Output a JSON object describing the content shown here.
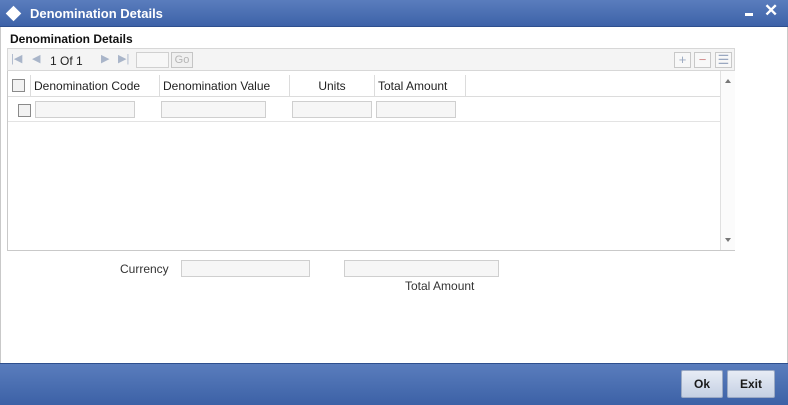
{
  "window": {
    "title": "Denomination Details",
    "icon": "diamond-icon",
    "minimize_icon": "minimize-icon",
    "close_icon": "close-icon",
    "close_glyph": "✕"
  },
  "section": {
    "label": "Denomination Details"
  },
  "toolbar": {
    "first_glyph": "|◀",
    "prev_glyph": "◀",
    "next_glyph": "▶",
    "last_glyph": "▶|",
    "page_text": "1 Of 1",
    "goto_value": "",
    "go_label": "Go",
    "add_glyph": "+",
    "delete_glyph": "−",
    "view_glyph": "☰"
  },
  "grid": {
    "columns": [
      "Denomination Code",
      "Denomination Value",
      "Units",
      "Total Amount"
    ],
    "rows": [
      {
        "code": "",
        "value": "",
        "units": "",
        "total": ""
      }
    ]
  },
  "summary": {
    "currency_label": "Currency",
    "currency_value": "",
    "total_amount_label": "Total Amount",
    "total_amount_value": ""
  },
  "footer": {
    "ok_label": "Ok",
    "exit_label": "Exit"
  },
  "colors": {
    "titlebar": "#3d62a8",
    "footer": "#4a6eb3"
  }
}
